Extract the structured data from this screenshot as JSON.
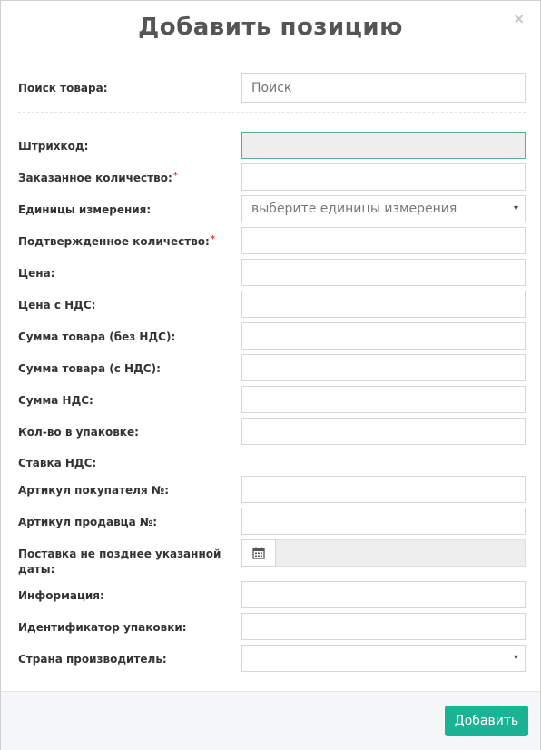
{
  "modal": {
    "title": "Добавить позицию",
    "close": "×"
  },
  "search": {
    "label": "Поиск товара:",
    "placeholder": "Поиск"
  },
  "fields": {
    "barcode": {
      "label": "Штрихкод:",
      "value": ""
    },
    "ordered_qty": {
      "label": "Заказанное количество:",
      "required_mark": "*",
      "value": ""
    },
    "units": {
      "label": "Единицы измерения:",
      "selected": "выберите единицы измерения",
      "caret": "▾"
    },
    "confirmed_qty": {
      "label": "Подтвержденное количество:",
      "required_mark": "*",
      "value": ""
    },
    "price": {
      "label": "Цена:",
      "value": ""
    },
    "price_vat": {
      "label": "Цена с НДС:",
      "value": ""
    },
    "sum_no_vat": {
      "label": "Сумма товара (без НДС):",
      "value": ""
    },
    "sum_vat": {
      "label": "Сумма товара (с НДС):",
      "value": ""
    },
    "vat_sum": {
      "label": "Сумма НДС:",
      "value": ""
    },
    "pack_qty": {
      "label": "Кол-во в упаковке:",
      "value": ""
    },
    "vat_rate": {
      "label": "Ставка НДС:"
    },
    "buyer_article": {
      "label": "Артикул покупателя №:",
      "value": ""
    },
    "seller_article": {
      "label": "Артикул продавца №:",
      "value": ""
    },
    "delivery_date": {
      "label_line1": "Поставка не позднее указанной",
      "label_line2": "даты:",
      "value": ""
    },
    "info": {
      "label": "Информация:",
      "value": ""
    },
    "package_id": {
      "label": "Идентификатор упаковки:",
      "value": ""
    },
    "country": {
      "label": "Страна производитель:",
      "selected": "",
      "caret": "▾"
    }
  },
  "footer": {
    "submit_label": "Добавить"
  },
  "colors": {
    "accent": "#1cb394",
    "required": "#e23a3a"
  },
  "icons": {
    "calendar": "calendar-icon",
    "close": "close-icon"
  }
}
